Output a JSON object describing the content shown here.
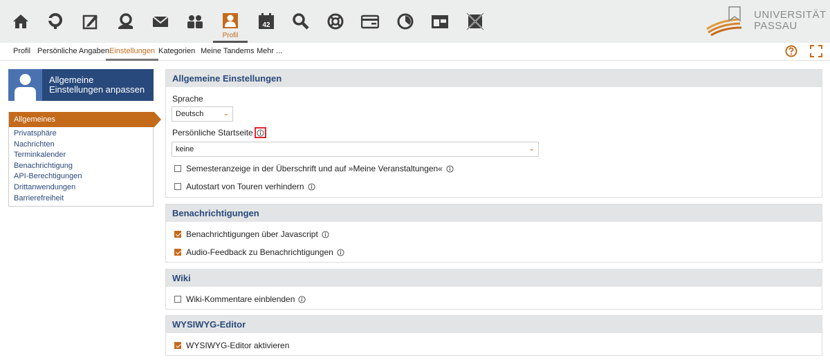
{
  "header": {
    "active_label": "Profil",
    "logo_line1": "UNIVERSITÄT",
    "logo_line2": "PASSAU",
    "calendar_number": "42"
  },
  "subnav": {
    "tabs": [
      "Profil",
      "Persönliche Angaben",
      "Einstellungen",
      "Kategorien",
      "Meine Tandems",
      "Mehr ..."
    ],
    "active": "Einstellungen"
  },
  "sidebar": {
    "banner_title_1": "Allgemeine",
    "banner_title_2": "Einstellungen anpassen",
    "items": [
      "Allgemeines",
      "Privatsphäre",
      "Nachrichten",
      "Terminkalender",
      "Benachrichtigung",
      "API-Berechtigungen",
      "Drittanwendungen",
      "Barrierefreiheit"
    ],
    "active": "Allgemeines"
  },
  "panels": {
    "general": {
      "title": "Allgemeine Einstellungen",
      "language_label": "Sprache",
      "language_value": "Deutsch",
      "startpage_label": "Persönliche Startseite",
      "startpage_value": "keine",
      "semester_label": "Semesteranzeige in der Überschrift und auf »Meine Veranstaltungen«",
      "semester_checked": false,
      "autostart_label": "Autostart von Touren verhindern",
      "autostart_checked": false
    },
    "notifications": {
      "title": "Benachrichtigungen",
      "js_label": "Benachrichtigungen über Javascript",
      "js_checked": true,
      "audio_label": "Audio-Feedback zu Benachrichtigungen",
      "audio_checked": true
    },
    "wiki": {
      "title": "Wiki",
      "comments_label": "Wiki-Kommentare einblenden",
      "comments_checked": false
    },
    "wysiwyg": {
      "title": "WYSIWYG-Editor",
      "enable_label": "WYSIWYG-Editor aktivieren",
      "enable_checked": true
    }
  },
  "colors": {
    "accent": "#c46a1b",
    "navy": "#28497c",
    "icon": "#3c3c3c",
    "highlight": "#e0282f"
  }
}
